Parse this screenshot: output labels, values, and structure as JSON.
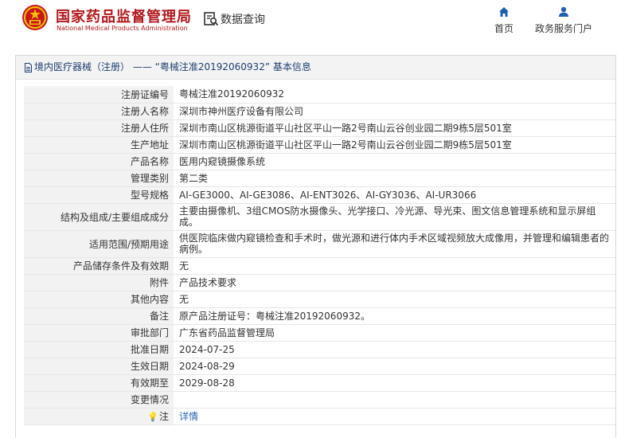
{
  "header": {
    "site_name_zh": "国家药品监督管理局",
    "site_name_en": "National Medical Products Administration",
    "query_label": "数据查询",
    "nav": {
      "home": "首页",
      "portal": "政务服务门户"
    }
  },
  "panel": {
    "title": "境内医疗器械（注册） —— “粤械注准20192060932” 基本信息"
  },
  "rows": [
    {
      "label": "注册证编号",
      "value": "粤械注准20192060932"
    },
    {
      "label": "注册人名称",
      "value": "深圳市神州医疗设备有限公司"
    },
    {
      "label": "注册人住所",
      "value": "深圳市南山区桃源街道平山社区平山一路2号南山云谷创业园二期9栋5层501室"
    },
    {
      "label": "生产地址",
      "value": "深圳市南山区桃源街道平山社区平山一路2号南山云谷创业园二期9栋5层501室"
    },
    {
      "label": "产品名称",
      "value": "医用内窥镜摄像系统"
    },
    {
      "label": "管理类别",
      "value": "第二类"
    },
    {
      "label": "型号规格",
      "value": "AI-GE3000、AI-GE3086、AI-ENT3026、AI-GY3036、AI-UR3066"
    },
    {
      "label": "结构及组成/主要组成成分",
      "value": "主要由摄像机、3组CMOS防水摄像头、光学接口、冷光源、导光束、图文信息管理系统和显示屏组成。"
    },
    {
      "label": "适用范围/预期用途",
      "value": "供医院临床做内窥镜检查和手术时，做光源和进行体内手术区域视频放大成像用，并管理和编辑患者的病例。"
    },
    {
      "label": "产品储存条件及有效期",
      "value": "无"
    },
    {
      "label": "附件",
      "value": "产品技术要求"
    },
    {
      "label": "其他内容",
      "value": "无"
    },
    {
      "label": "备注",
      "value": "原产品注册证号：粤械注准20192060932。"
    },
    {
      "label": "审批部门",
      "value": "广东省药品监督管理局"
    },
    {
      "label": "批准日期",
      "value": "2024-07-25"
    },
    {
      "label": "生效日期",
      "value": "2024-08-29"
    },
    {
      "label": "有效期至",
      "value": "2029-08-28"
    },
    {
      "label": "变更情况",
      "value": ""
    }
  ],
  "note_row": {
    "label": "注",
    "link": "详情"
  },
  "colors": {
    "brand_red": "#b3181c",
    "title_blue": "#1f3f6f",
    "link_blue": "#2a66b3",
    "nav_blue": "#1e5fb4"
  },
  "icons": {
    "emblem": "national-emblem-icon",
    "query": "data-query-icon",
    "home": "home-icon",
    "portal": "user-icon",
    "doc": "document-icon",
    "note": "bulb-icon"
  }
}
